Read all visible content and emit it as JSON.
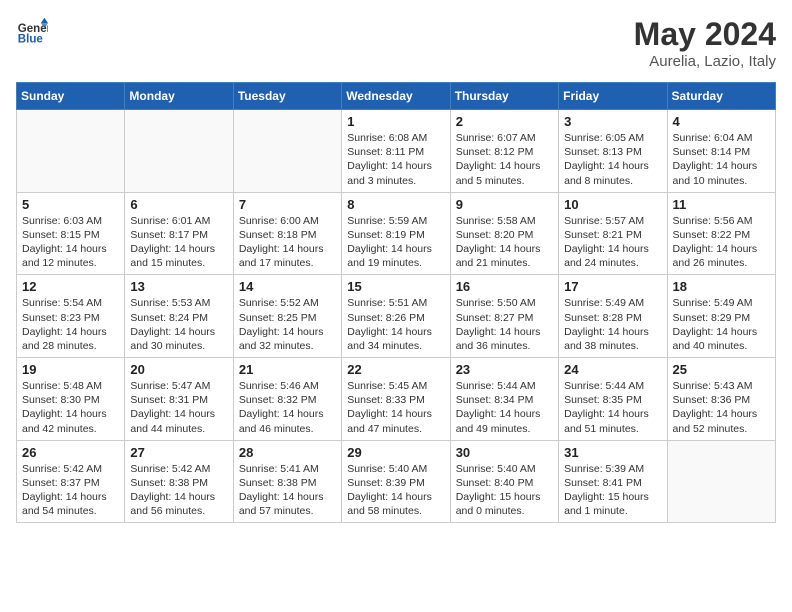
{
  "header": {
    "logo_general": "General",
    "logo_blue": "Blue",
    "title": "May 2024",
    "subtitle": "Aurelia, Lazio, Italy"
  },
  "days_of_week": [
    "Sunday",
    "Monday",
    "Tuesday",
    "Wednesday",
    "Thursday",
    "Friday",
    "Saturday"
  ],
  "weeks": [
    [
      {
        "day": "",
        "info": ""
      },
      {
        "day": "",
        "info": ""
      },
      {
        "day": "",
        "info": ""
      },
      {
        "day": "1",
        "info": "Sunrise: 6:08 AM\nSunset: 8:11 PM\nDaylight: 14 hours\nand 3 minutes."
      },
      {
        "day": "2",
        "info": "Sunrise: 6:07 AM\nSunset: 8:12 PM\nDaylight: 14 hours\nand 5 minutes."
      },
      {
        "day": "3",
        "info": "Sunrise: 6:05 AM\nSunset: 8:13 PM\nDaylight: 14 hours\nand 8 minutes."
      },
      {
        "day": "4",
        "info": "Sunrise: 6:04 AM\nSunset: 8:14 PM\nDaylight: 14 hours\nand 10 minutes."
      }
    ],
    [
      {
        "day": "5",
        "info": "Sunrise: 6:03 AM\nSunset: 8:15 PM\nDaylight: 14 hours\nand 12 minutes."
      },
      {
        "day": "6",
        "info": "Sunrise: 6:01 AM\nSunset: 8:17 PM\nDaylight: 14 hours\nand 15 minutes."
      },
      {
        "day": "7",
        "info": "Sunrise: 6:00 AM\nSunset: 8:18 PM\nDaylight: 14 hours\nand 17 minutes."
      },
      {
        "day": "8",
        "info": "Sunrise: 5:59 AM\nSunset: 8:19 PM\nDaylight: 14 hours\nand 19 minutes."
      },
      {
        "day": "9",
        "info": "Sunrise: 5:58 AM\nSunset: 8:20 PM\nDaylight: 14 hours\nand 21 minutes."
      },
      {
        "day": "10",
        "info": "Sunrise: 5:57 AM\nSunset: 8:21 PM\nDaylight: 14 hours\nand 24 minutes."
      },
      {
        "day": "11",
        "info": "Sunrise: 5:56 AM\nSunset: 8:22 PM\nDaylight: 14 hours\nand 26 minutes."
      }
    ],
    [
      {
        "day": "12",
        "info": "Sunrise: 5:54 AM\nSunset: 8:23 PM\nDaylight: 14 hours\nand 28 minutes."
      },
      {
        "day": "13",
        "info": "Sunrise: 5:53 AM\nSunset: 8:24 PM\nDaylight: 14 hours\nand 30 minutes."
      },
      {
        "day": "14",
        "info": "Sunrise: 5:52 AM\nSunset: 8:25 PM\nDaylight: 14 hours\nand 32 minutes."
      },
      {
        "day": "15",
        "info": "Sunrise: 5:51 AM\nSunset: 8:26 PM\nDaylight: 14 hours\nand 34 minutes."
      },
      {
        "day": "16",
        "info": "Sunrise: 5:50 AM\nSunset: 8:27 PM\nDaylight: 14 hours\nand 36 minutes."
      },
      {
        "day": "17",
        "info": "Sunrise: 5:49 AM\nSunset: 8:28 PM\nDaylight: 14 hours\nand 38 minutes."
      },
      {
        "day": "18",
        "info": "Sunrise: 5:49 AM\nSunset: 8:29 PM\nDaylight: 14 hours\nand 40 minutes."
      }
    ],
    [
      {
        "day": "19",
        "info": "Sunrise: 5:48 AM\nSunset: 8:30 PM\nDaylight: 14 hours\nand 42 minutes."
      },
      {
        "day": "20",
        "info": "Sunrise: 5:47 AM\nSunset: 8:31 PM\nDaylight: 14 hours\nand 44 minutes."
      },
      {
        "day": "21",
        "info": "Sunrise: 5:46 AM\nSunset: 8:32 PM\nDaylight: 14 hours\nand 46 minutes."
      },
      {
        "day": "22",
        "info": "Sunrise: 5:45 AM\nSunset: 8:33 PM\nDaylight: 14 hours\nand 47 minutes."
      },
      {
        "day": "23",
        "info": "Sunrise: 5:44 AM\nSunset: 8:34 PM\nDaylight: 14 hours\nand 49 minutes."
      },
      {
        "day": "24",
        "info": "Sunrise: 5:44 AM\nSunset: 8:35 PM\nDaylight: 14 hours\nand 51 minutes."
      },
      {
        "day": "25",
        "info": "Sunrise: 5:43 AM\nSunset: 8:36 PM\nDaylight: 14 hours\nand 52 minutes."
      }
    ],
    [
      {
        "day": "26",
        "info": "Sunrise: 5:42 AM\nSunset: 8:37 PM\nDaylight: 14 hours\nand 54 minutes."
      },
      {
        "day": "27",
        "info": "Sunrise: 5:42 AM\nSunset: 8:38 PM\nDaylight: 14 hours\nand 56 minutes."
      },
      {
        "day": "28",
        "info": "Sunrise: 5:41 AM\nSunset: 8:38 PM\nDaylight: 14 hours\nand 57 minutes."
      },
      {
        "day": "29",
        "info": "Sunrise: 5:40 AM\nSunset: 8:39 PM\nDaylight: 14 hours\nand 58 minutes."
      },
      {
        "day": "30",
        "info": "Sunrise: 5:40 AM\nSunset: 8:40 PM\nDaylight: 15 hours\nand 0 minutes."
      },
      {
        "day": "31",
        "info": "Sunrise: 5:39 AM\nSunset: 8:41 PM\nDaylight: 15 hours\nand 1 minute."
      },
      {
        "day": "",
        "info": ""
      }
    ]
  ]
}
